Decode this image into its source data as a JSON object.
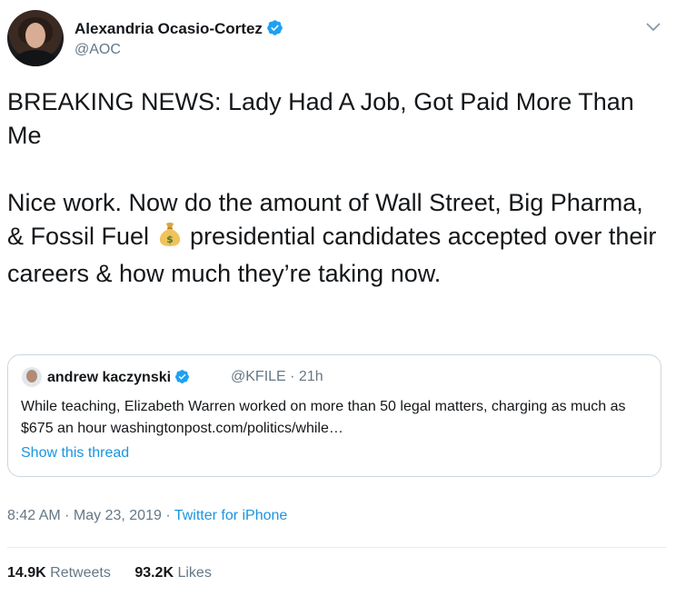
{
  "author": {
    "name": "Alexandria Ocasio-Cortez",
    "handle": "@AOC"
  },
  "tweet": {
    "text_line1": "BREAKING NEWS: Lady Had A Job, Got Paid More Than Me",
    "text_part2_before_emoji": "Nice work. Now do the amount of Wall Street, Big Pharma, & Fossil Fuel ",
    "emoji": "money-bag",
    "text_part2_after_emoji": " presidential candidates accepted over their careers & how much they’re taking now."
  },
  "quote": {
    "name": "andrew kaczynski",
    "handle": "@KFILE",
    "time": "21h",
    "text": "While teaching, Elizabeth Warren worked on more than 50 legal matters, charging as much as $675 an hour washingtonpost.com/politics/while…",
    "show_thread": "Show this thread"
  },
  "meta": {
    "time": "8:42 AM",
    "date": "May 23, 2019",
    "source": "Twitter for iPhone"
  },
  "stats": {
    "retweets_count": "14.9K",
    "retweets_label": "Retweets",
    "likes_count": "93.2K",
    "likes_label": "Likes"
  },
  "colors": {
    "link": "#1b95e0",
    "secondary": "#657786",
    "verified": "#1da1f2"
  }
}
